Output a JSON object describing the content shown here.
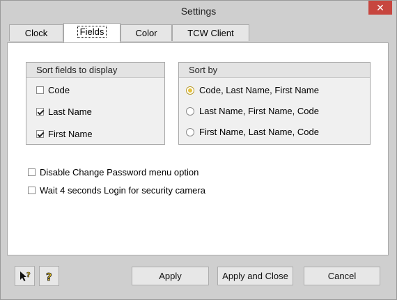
{
  "window": {
    "title": "Settings"
  },
  "tabs": [
    {
      "label": "Clock"
    },
    {
      "label": "Fields"
    },
    {
      "label": "Color"
    },
    {
      "label": "TCW Client"
    }
  ],
  "active_tab": "Fields",
  "sort_fields": {
    "header": "Sort fields to display",
    "items": [
      {
        "label": "Code",
        "checked": false
      },
      {
        "label": "Last Name",
        "checked": true
      },
      {
        "label": "First Name",
        "checked": true
      }
    ]
  },
  "sort_by": {
    "header": "Sort by",
    "options": [
      {
        "label": "Code, Last Name, First Name",
        "selected": true
      },
      {
        "label": "Last Name, First Name, Code",
        "selected": false
      },
      {
        "label": "First Name, Last Name, Code",
        "selected": false
      }
    ]
  },
  "options": [
    {
      "label": "Disable Change Password menu option",
      "checked": false
    },
    {
      "label": "Wait 4 seconds Login for security camera",
      "checked": false
    }
  ],
  "buttons": {
    "apply": "Apply",
    "apply_close": "Apply and Close",
    "cancel": "Cancel"
  },
  "icons": {
    "context_help": "pointer-help-icon",
    "help": "help-icon",
    "close": "close-icon"
  },
  "colors": {
    "close_button": "#c7463f",
    "radio_selected": "#e6c23c"
  }
}
